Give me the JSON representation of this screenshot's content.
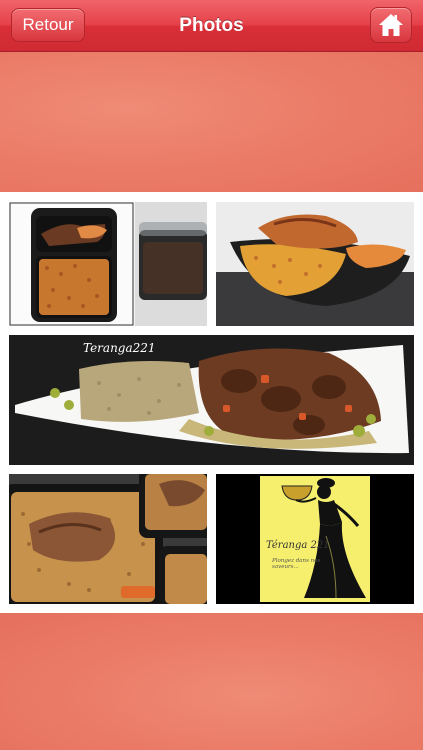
{
  "nav": {
    "back_label": "Retour",
    "title": "Photos",
    "home_icon": "home-icon"
  },
  "gallery": {
    "photos": [
      {
        "name": "photo-meal-tray-rice-fish"
      },
      {
        "name": "photo-plated-rice-fish"
      },
      {
        "name": "photo-couscous-meat-plate",
        "caption": "Teranga221"
      },
      {
        "name": "photo-meal-trays-rice-chicken"
      },
      {
        "name": "photo-teranga221-logo",
        "logo_text": "Téranga 221",
        "logo_tagline": "Plongez dans nos saveurs..."
      }
    ]
  },
  "colors": {
    "nav_red": "#e6414a",
    "background_salmon": "#ec7b67",
    "logo_yellow": "#f6ef6e"
  }
}
